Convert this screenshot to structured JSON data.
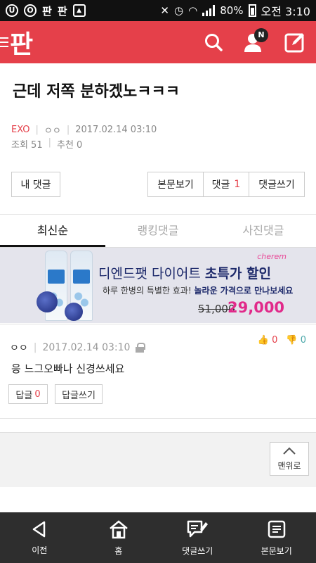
{
  "status_bar": {
    "left_icons": [
      "U",
      "O",
      "판",
      "판",
      "image"
    ],
    "battery": "80%",
    "time": "오전 3:10"
  },
  "header": {
    "logo": "판",
    "icons": [
      "search-icon",
      "user-icon",
      "write-icon"
    ],
    "notification_badge": "N"
  },
  "post": {
    "title": "근데 저쪽 분하겠노ㅋㅋㅋ",
    "category": "EXO",
    "author": "ㅇㅇ",
    "date": "2017.02.14 03:10",
    "views": "조회 51",
    "recommend": "추천 0"
  },
  "actions": {
    "my_comments": "내 댓글",
    "view_post": "본문보기",
    "comments_label": "댓글",
    "comments_count": "1",
    "write_comment": "댓글쓰기"
  },
  "tabs": [
    {
      "label": "최신순",
      "active": true
    },
    {
      "label": "랭킹댓글",
      "active": false
    },
    {
      "label": "사진댓글",
      "active": false
    }
  ],
  "ad": {
    "brand": "cherem",
    "line1_a": "디엔드팻 다이어트 ",
    "line1_b": "초특가 할인",
    "line2_a": "하루 한병의 특별한 효과! ",
    "line2_b": "놀라운 가격으로 만나보세요",
    "old_price": "51,000",
    "new_price": "29,000"
  },
  "comment": {
    "author": "ㅇㅇ",
    "date": "2017.02.14 03:10",
    "up_votes": "0",
    "down_votes": "0",
    "text": "응 느그오빠나 신경쓰세요",
    "reply_label": "답글",
    "reply_count": "0",
    "write_reply": "답글쓰기"
  },
  "to_top": "맨위로",
  "bottom_nav": [
    "이전",
    "홈",
    "댓글쓰기",
    "본문보기"
  ]
}
